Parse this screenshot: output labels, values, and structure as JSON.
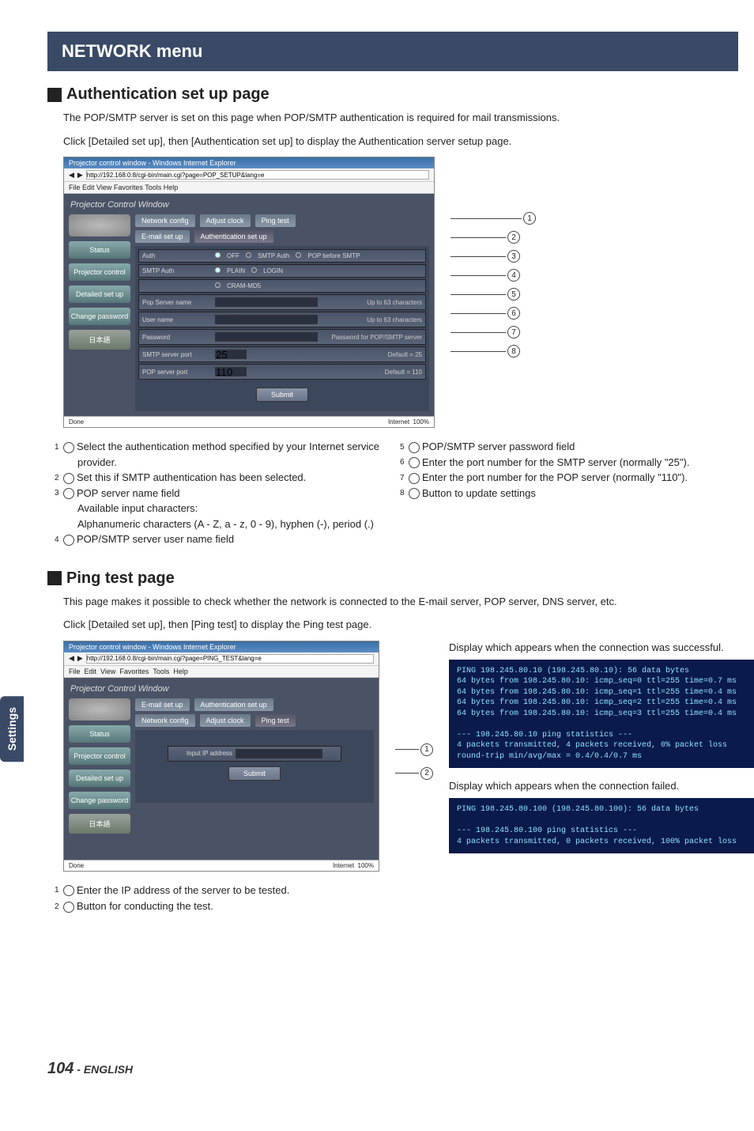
{
  "side_tab": "Settings",
  "page_number": "104",
  "page_suffix": " - ENGLISH",
  "menu_title": "NETWORK menu",
  "auth": {
    "heading": "Authentication set up page",
    "intro1": "The POP/SMTP server is set on this page when POP/SMTP authentication is required for mail transmissions.",
    "intro2": "Click [Detailed set up], then [Authentication set up] to display the Authentication server setup page.",
    "left": {
      "n1": "Select the authentication method specified by your Internet service provider.",
      "n2": "Set this if SMTP authentication has been selected.",
      "n3a": "POP server name field",
      "n3b": "Available input characters:",
      "n3c": "Alphanumeric characters (A - Z, a - z, 0 - 9), hyphen (-), period (.)",
      "n4": "POP/SMTP server user name field"
    },
    "right": {
      "n5": "POP/SMTP server password field",
      "n6": "Enter the port number for the SMTP server (normally \"25\").",
      "n7": "Enter the port number for the POP server (normally \"110\").",
      "n8": "Button to update settings"
    },
    "shot": {
      "win_title": "Projector control window - Windows Internet Explorer",
      "addr": "http://192.168.0.8/cgi-bin/main.cgi?page=POP_SETUP&lang=e",
      "menu": "File  Edit  View  Favorites  Tools  Help",
      "pcw": "Projector Control Window",
      "side": {
        "status": "Status",
        "projector": "Projector control",
        "detailed": "Detailed set up",
        "change": "Change password",
        "jp": "日本語"
      },
      "tabs": {
        "netcfg": "Network config",
        "adj": "Adjust clock",
        "ping": "Ping test",
        "email": "E-mail set up",
        "authset": "Authentication set up"
      },
      "rows": {
        "auth_lab": "Auth",
        "auth_off": "OFF",
        "auth_smtp": "SMTP Auth",
        "auth_pop": "POP before SMTP",
        "smtp_lab": "SMTP Auth",
        "smtp_plain": "PLAIN",
        "smtp_login": "LOGIN",
        "smtp_cram": "CRAM-MD5",
        "popname_lab": "Pop Server name",
        "popname_note": "Up to 63 characters",
        "user_lab": "User name",
        "user_note": "Up to 63 characters",
        "pass_lab": "Password",
        "pass_note": "Password for POP/SMTP server",
        "smtpport_lab": "SMTP server port",
        "smtpport_val": "25",
        "smtpport_note": "Default = 25",
        "popport_lab": "POP server port",
        "popport_val": "110",
        "popport_note": "Default = 110",
        "submit": "Submit"
      },
      "status_done": "Done",
      "status_net": "Internet",
      "status_zoom": "100%"
    },
    "callouts": [
      "1",
      "2",
      "3",
      "4",
      "5",
      "6",
      "7",
      "8"
    ]
  },
  "ping": {
    "heading": "Ping test page",
    "intro1": "This page makes it possible to check whether the network is connected to the E-mail server, POP server, DNS server, etc.",
    "intro2": "Click [Detailed set up], then [Ping test] to display the Ping test page.",
    "shot": {
      "win_title": "Projector control window - Windows Internet Explorer",
      "addr": "http://192.168.0.8/cgi-bin/main.cgi?page=PING_TEST&lang=e",
      "pcw": "Projector Control Window",
      "side": {
        "status": "Status",
        "projector": "Projector control",
        "detailed": "Detailed set up",
        "change": "Change password",
        "jp": "日本語"
      },
      "tabs": {
        "email": "E-mail set up",
        "authset": "Authentication set up",
        "netcfg": "Network config",
        "adj": "Adjust clock",
        "ping": "Ping test"
      },
      "ip_lab": "Input IP address",
      "submit": "Submit",
      "status_done": "Done",
      "status_net": "Internet",
      "status_zoom": "100%"
    },
    "callouts": [
      "1",
      "2"
    ],
    "notes": {
      "n1": "Enter the IP address of the server to be tested.",
      "n2": "Button for conducting the test."
    },
    "ok_cap": "Display which appears when the connection was successful.",
    "ok_term": "PING 198.245.80.10 (198.245.80.10): 56 data bytes\n64 bytes from 198.245.80.10: icmp_seq=0 ttl=255 time=0.7 ms\n64 bytes from 198.245.80.10: icmp_seq=1 ttl=255 time=0.4 ms\n64 bytes from 198.245.80.10: icmp_seq=2 ttl=255 time=0.4 ms\n64 bytes from 198.245.80.10: icmp_seq=3 ttl=255 time=0.4 ms\n\n--- 198.245.80.10 ping statistics ---\n4 packets transmitted, 4 packets received, 0% packet loss\nround-trip min/avg/max = 0.4/0.4/0.7 ms",
    "fail_cap": "Display which appears when the connection failed.",
    "fail_term": "PING 198.245.80.100 (198.245.80.100): 56 data bytes\n\n--- 198.245.80.100 ping statistics ---\n4 packets transmitted, 0 packets received, 100% packet loss"
  }
}
